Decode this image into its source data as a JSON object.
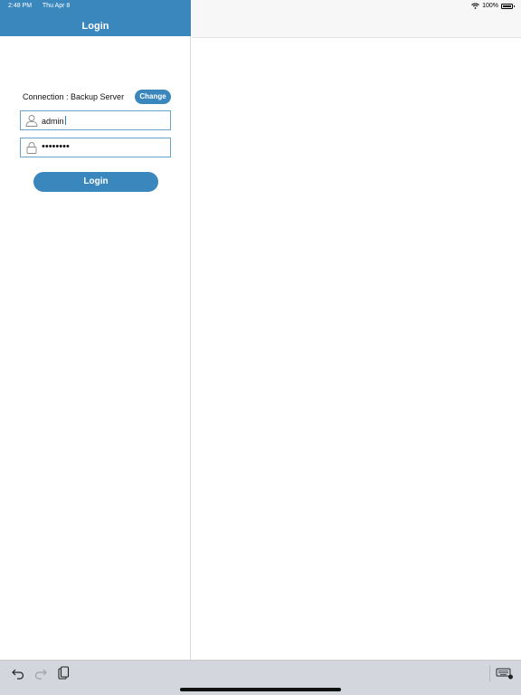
{
  "status_bar": {
    "time": "2:48 PM",
    "date": "Thu Apr 8",
    "battery": "100%"
  },
  "nav": {
    "title": "Login"
  },
  "form": {
    "connection_label": "Connection : Backup Server",
    "change_label": "Change",
    "username_value": "admin",
    "password_value": "••••••••",
    "login_label": "Login"
  },
  "icons": {
    "user": "user-icon",
    "lock": "lock-icon",
    "wifi": "wifi-icon",
    "battery": "battery-icon",
    "undo": "undo-icon",
    "redo": "redo-icon",
    "paste": "paste-icon",
    "keyboard": "keyboard-icon"
  },
  "colors": {
    "accent": "#3a87be",
    "field_border": "#6aa2cc",
    "keyboard_bar": "#d3d6dc"
  }
}
